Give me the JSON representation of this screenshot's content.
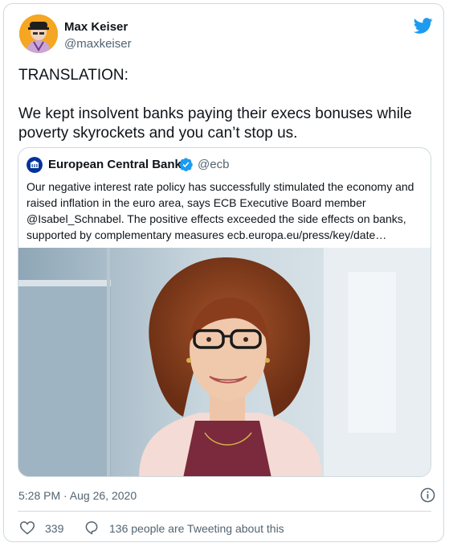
{
  "tweet": {
    "author_name": "Max Keiser",
    "author_handle": "@maxkeiser",
    "text_paragraphs": [
      "TRANSLATION:",
      "We kept insolvent banks paying their execs bonuses while poverty skyrockets and you can’t stop us."
    ],
    "timestamp": "5:28 PM · Aug 26, 2020",
    "like_count": "339",
    "discussion_label": "136 people are Tweeting about this"
  },
  "quoted_tweet": {
    "author_name": "European Central Bank",
    "author_handle": "@ecb",
    "text": "Our negative interest rate policy has successfully stimulated the economy and raised inflation in the euro area, says ECB Executive Board member @Isabel_Schnabel. The positive effects exceeded the side effects on banks, supported by complementary measures ecb.europa.eu/press/key/date…"
  },
  "icons": {
    "twitter_logo": "twitter-bird-icon",
    "verified": "verified-badge-icon",
    "info": "info-icon",
    "like": "heart-icon",
    "reply": "speech-bubble-icon"
  },
  "colors": {
    "twitter_blue": "#1d9bf0",
    "secondary_text": "#536471",
    "border": "#cfd9de",
    "ecb_blue": "#003299"
  }
}
